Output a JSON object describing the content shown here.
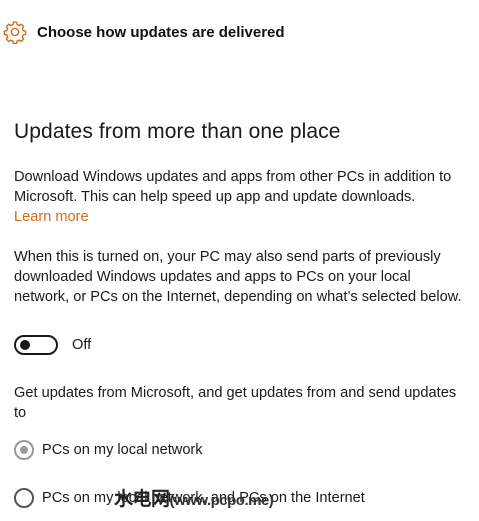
{
  "header": {
    "icon": "gear-icon",
    "title": "Choose how updates are delivered",
    "accent_color": "#d26c19"
  },
  "section": {
    "title": "Updates from more than one place",
    "description": "Download Windows updates and apps from other PCs in addition to Microsoft. This can help speed up app and update downloads.",
    "learn_more": "Learn more",
    "info": "When this is turned on, your PC may also send parts of previously downloaded Windows updates and apps to PCs on your local network, or PCs on the Internet, depending on what’s selected below."
  },
  "toggle": {
    "state": "off",
    "label": "Off"
  },
  "sources": {
    "prompt": "Get updates from Microsoft, and get updates from and send updates to",
    "options": [
      {
        "label": "PCs on my local network",
        "selected": true,
        "enabled": false
      },
      {
        "label": "PCs on my local network, and PCs on the Internet",
        "selected": false,
        "enabled": true
      }
    ]
  },
  "watermark": {
    "text": "水电网",
    "url": "(www.pcpo.me)"
  }
}
